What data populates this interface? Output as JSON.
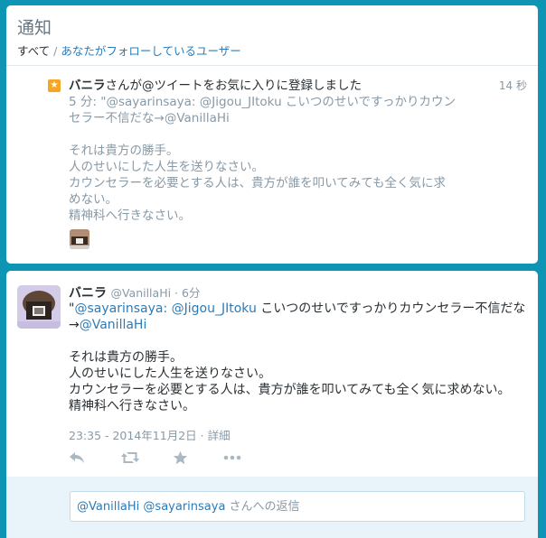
{
  "header": {
    "title": "通知",
    "filter_current": "すべて",
    "filter_sep": " / ",
    "filter_other": "あなたがフォローしているユーザー"
  },
  "notification": {
    "actor": "バニラ",
    "action_text": "さんが@ツイートをお気に入りに登録しました",
    "time": "14 秒",
    "quote_prefix": "5 分: \"",
    "quote_mention1": "@sayarinsaya:",
    "quote_mention2": "@Jigou_JItoku",
    "quote_line1_rest": " こいつのせいですっかりカウン",
    "quote_line2": "セラー不信だな→",
    "quote_mention3": "@VanillaHi",
    "quote_para1": "それは貴方の勝手。",
    "quote_para2": "人のせいにした人生を送りなさい。",
    "quote_para3": "カウンセラーを必要とする人は、貴方が誰を叩いてみても全く気に求",
    "quote_para3b": "めない。",
    "quote_para4": "精神科へ行きなさい。"
  },
  "tweet": {
    "name": "バニラ",
    "handle": "@VanillaHi",
    "dot": " · ",
    "ago": "6分",
    "quote_open": "\"",
    "mention1": "@sayarinsaya:",
    "mention2": "@Jigou_JItoku",
    "line1_rest": " こいつのせいですっかりカウンセラー不信だな",
    "arrow": "→",
    "mention3": "@VanillaHi",
    "para1": "それは貴方の勝手。",
    "para2": "人のせいにした人生を送りなさい。",
    "para3": "カウンセラーを必要とする人は、貴方が誰を叩いてみても全く気に求めない。",
    "para4": "精神科へ行きなさい。",
    "timestamp": "23:35 - 2014年11月2日",
    "meta_sep": " · ",
    "details": "詳細"
  },
  "actions": {
    "reply_icon": "reply-icon",
    "retweet_icon": "retweet-icon",
    "favorite_icon": "favorite-icon",
    "more_icon": "more-icon"
  },
  "reply": {
    "mention1": "@VanillaHi",
    "mention2": "@sayarinsaya",
    "placeholder_rest": " さんへの返信"
  },
  "colors": {
    "background": "#0f95b4",
    "link": "#2b7bb9",
    "muted": "#8899a6",
    "star": "#f6a623"
  }
}
